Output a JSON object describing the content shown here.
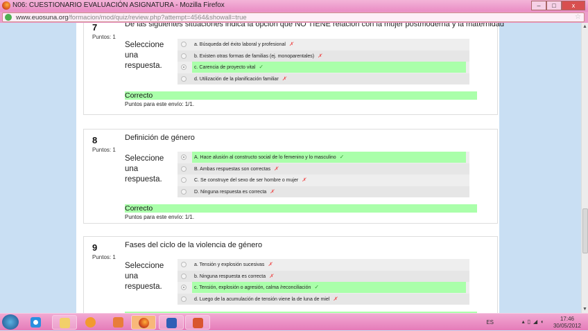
{
  "window": {
    "title": "N06: CUESTIONARIO EVALUACIÓN ASIGNATURA - Mozilla Firefox",
    "buttons": {
      "minimize": "–",
      "maximize": "□",
      "close": "x"
    }
  },
  "address_bar": {
    "domain": "www.euosuna.org",
    "path": "/formacion/mod/quiz/review.php?attempt=4564&showall=true"
  },
  "questions": [
    {
      "number": "7",
      "points": "Puntos: 1",
      "text": "De las siguientes situaciones indica la opción que NO TIENE relación con la mujer postmoderna y la maternidad",
      "select_label": "Seleccione una respuesta.",
      "answers": [
        {
          "label": "a. Búsqueda del éxito laboral y profesional",
          "mark": "✗",
          "selected": false,
          "correct": false
        },
        {
          "label": "b. Existen otras formas de familias (ej. monoparentales)",
          "mark": "✗",
          "selected": false,
          "correct": false
        },
        {
          "label": "c. Carencia de proyecto vital",
          "mark": "✓",
          "selected": true,
          "correct": true
        },
        {
          "label": "d. Utilización de la planificación familiar",
          "mark": "✗",
          "selected": false,
          "correct": false
        }
      ],
      "result": "Correcto",
      "score": "Puntos para este envío: 1/1."
    },
    {
      "number": "8",
      "points": "Puntos: 1",
      "text": "Definición de género",
      "select_label": "Seleccione una respuesta.",
      "answers": [
        {
          "label": "A. Hace alusión al constructo social de lo femenino y lo masculino",
          "mark": "✓",
          "selected": true,
          "correct": true
        },
        {
          "label": "B. Ambas respuestas son correctas",
          "mark": "✗",
          "selected": false,
          "correct": false
        },
        {
          "label": "C. Se construye del sexo de ser hombre o mujer",
          "mark": "✗",
          "selected": false,
          "correct": false
        },
        {
          "label": "D. Ninguna respuesta es correcta",
          "mark": "✗",
          "selected": false,
          "correct": false
        }
      ],
      "result": "Correcto",
      "score": "Puntos para este envío: 1/1."
    },
    {
      "number": "9",
      "points": "Puntos: 1",
      "text": "Fases del ciclo de la violencia de género",
      "select_label": "Seleccione una respuesta.",
      "answers": [
        {
          "label": "a. Tensión y explosión sucesivas",
          "mark": "✗",
          "selected": false,
          "correct": false
        },
        {
          "label": "b. Ninguna respuesta es correcta",
          "mark": "✗",
          "selected": false,
          "correct": false
        },
        {
          "label": "c. Tensión, explosión o agresión, calma /reconciliación",
          "mark": "✓",
          "selected": true,
          "correct": true
        },
        {
          "label": "d. Luego de la acumulación de tensión viene la de luna de miel",
          "mark": "✗",
          "selected": false,
          "correct": false
        }
      ]
    }
  ],
  "taskbar": {
    "apps": [
      "start",
      "internet-explorer",
      "file-explorer",
      "media-player",
      "paint",
      "firefox",
      "word",
      "powerpoint"
    ],
    "active": "firefox",
    "language": "ES",
    "time": "17:46",
    "date": "30/05/2012"
  },
  "colors": {
    "correct_bg": "#aaffaa",
    "wrong_mark": "#ee4444",
    "ok_mark": "#339933",
    "page_bg": "#c9dff3",
    "taskbar": "#e98cc4"
  }
}
